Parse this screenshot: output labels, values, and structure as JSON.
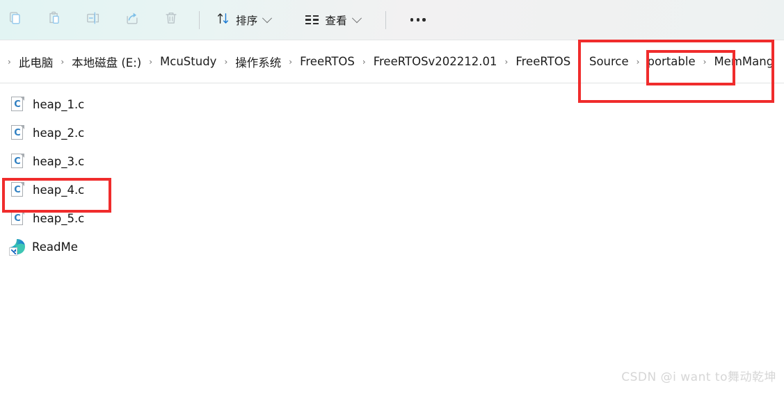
{
  "toolbar": {
    "buttons": [
      {
        "name": "copy-button",
        "icon": "copy-icon",
        "label": "复制"
      },
      {
        "name": "paste-button",
        "icon": "paste-icon",
        "label": "粘贴"
      },
      {
        "name": "rename-button",
        "icon": "rename-icon",
        "label": "重命名"
      },
      {
        "name": "share-button",
        "icon": "share-icon",
        "label": "共享"
      },
      {
        "name": "delete-button",
        "icon": "delete-icon",
        "label": "删除"
      }
    ],
    "sort": {
      "label": "排序",
      "icon": "sort-arrows-icon"
    },
    "view": {
      "label": "查看",
      "icon": "view-list-icon"
    },
    "more": {
      "label": "查看更多",
      "icon": "ellipsis-icon"
    }
  },
  "breadcrumb": {
    "leading_separator": "›",
    "separator": "›",
    "items": [
      "此电脑",
      "本地磁盘 (E:)",
      "McuStudy",
      "操作系统",
      "FreeRTOS",
      "FreeRTOSv202212.01",
      "FreeRTOS",
      "Source",
      "portable",
      "MemMang"
    ]
  },
  "files": [
    {
      "name": "heap_1.c",
      "icon": "c-file-icon"
    },
    {
      "name": "heap_2.c",
      "icon": "c-file-icon"
    },
    {
      "name": "heap_3.c",
      "icon": "c-file-icon"
    },
    {
      "name": "heap_4.c",
      "icon": "c-file-icon"
    },
    {
      "name": "heap_5.c",
      "icon": "c-file-icon"
    },
    {
      "name": "ReadMe",
      "icon": "edge-shortcut-icon"
    }
  ],
  "annotations": {
    "color": "#f02c2c",
    "boxes": [
      {
        "name": "breadcrumb-tail-highlight",
        "target": "portable › MemMang"
      },
      {
        "name": "memmang-highlight",
        "target": "MemMang"
      },
      {
        "name": "heap4-highlight",
        "target": "heap_4.c"
      }
    ]
  },
  "watermark": {
    "text": "CSDN @i want to舞动乾坤"
  }
}
